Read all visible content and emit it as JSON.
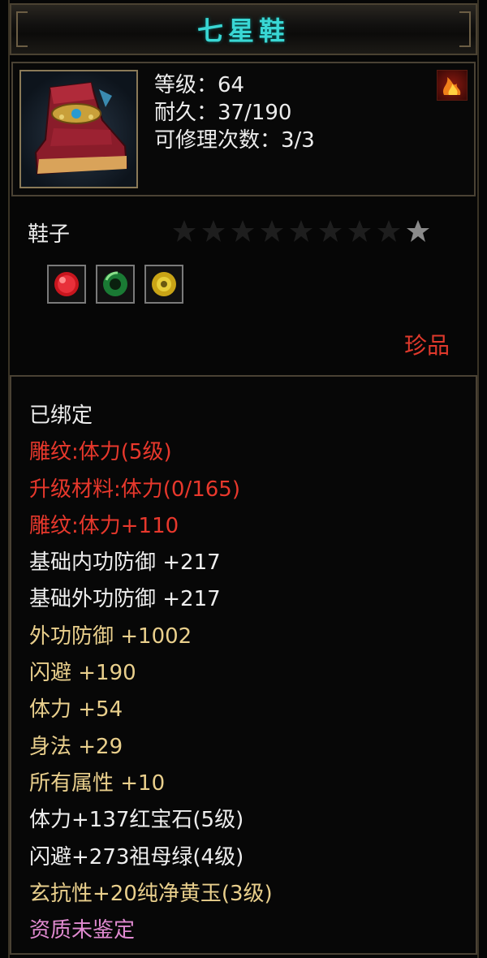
{
  "title": "七星鞋",
  "item": {
    "icon": "boot-icon",
    "level_label": "等级：64",
    "durability_label": "耐久：37/190",
    "repair_label": "可修理次数：3/3",
    "corner_icon": "flame-icon"
  },
  "type_label": "鞋子",
  "stars": {
    "total": 9,
    "filled": 1
  },
  "gems": [
    {
      "icon": "ruby-gem-icon",
      "color": "#d8222a"
    },
    {
      "icon": "emerald-gem-icon",
      "color": "#2ea04a"
    },
    {
      "icon": "yellow-jade-gem-icon",
      "color": "#d6b41c"
    }
  ],
  "rarity": "珍品",
  "attributes": [
    {
      "text": "已绑定",
      "color": "white"
    },
    {
      "text": "雕纹:体力(5级)",
      "color": "red"
    },
    {
      "text": "升级材料:体力(0/165)",
      "color": "red"
    },
    {
      "text": "雕纹:体力+110",
      "color": "red"
    },
    {
      "text": "基础内功防御  +217",
      "color": "white"
    },
    {
      "text": "基础外功防御  +217",
      "color": "white"
    },
    {
      "text": "外功防御  +1002",
      "color": "gold"
    },
    {
      "text": "闪避  +190",
      "color": "gold"
    },
    {
      "text": "体力  +54",
      "color": "gold"
    },
    {
      "text": "身法  +29",
      "color": "gold"
    },
    {
      "text": "所有属性  +10",
      "color": "gold"
    },
    {
      "text": "体力+137红宝石(5级)",
      "color": "white"
    },
    {
      "text": "闪避+273祖母绿(4级)",
      "color": "white"
    },
    {
      "text": "玄抗性+20纯净黄玉(3级)",
      "color": "gold"
    },
    {
      "text": "资质未鉴定",
      "color": "pink"
    }
  ],
  "colors": {
    "title": "#39d7d4",
    "red": "#e8382c",
    "gold": "#e9cf8c",
    "white": "#eeeeee",
    "pink": "#e08ad0"
  }
}
